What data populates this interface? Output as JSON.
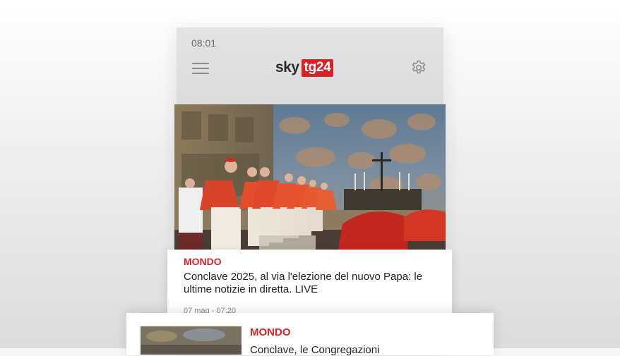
{
  "status_bar": {
    "time": "08:01"
  },
  "header": {
    "logo_sky": "sky",
    "logo_tg24": "tg24",
    "menu_icon": "hamburger-menu-icon",
    "settings_icon": "gear-icon"
  },
  "colors": {
    "brand_red": "#d52329",
    "header_bg": "#dcdcdc"
  },
  "feed": [
    {
      "category": "MONDO",
      "headline": "Conclave 2025, al via l'elezione del nuovo Papa: le ultime notizie in diretta. LIVE",
      "date": "07 mag - 07:20"
    },
    {
      "category": "MONDO",
      "headline": "Conclave, le Congregazioni"
    }
  ]
}
